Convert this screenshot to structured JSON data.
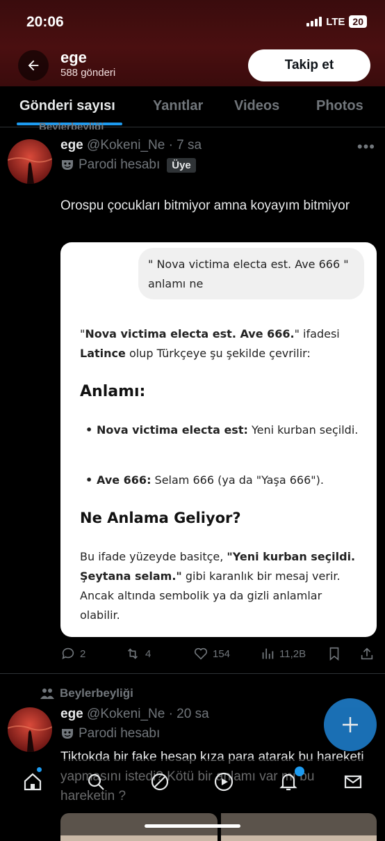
{
  "status": {
    "time": "20:06",
    "network": "LTE",
    "battery": "20"
  },
  "header": {
    "name": "ege",
    "post_count": "588 gönderi",
    "follow_label": "Takip et",
    "back_icon": "arrow-left-icon"
  },
  "tabs": [
    {
      "label": "Gönderi sayısı",
      "active": true
    },
    {
      "label": "Yanıtlar",
      "active": false
    },
    {
      "label": "Videos",
      "active": false
    },
    {
      "label": "Photos",
      "active": false
    }
  ],
  "ghost_social": "Beylerbeyliği",
  "tweet1": {
    "name": "ege",
    "handle": "@Kokeni_Ne",
    "time": "· 7 sa",
    "badge_text": "Parodi hesabı",
    "member_label": "Üye",
    "text": "Orospu çocukları bitmiyor amna koyayım bitmiyor",
    "card": {
      "bubble": "\" Nova victima electa est. Ave 666 \" anlamı ne",
      "intro_pre": "\"",
      "intro_bold": "Nova victima electa est. Ave 666.",
      "intro_mid": "\" ifadesi ",
      "intro_bold2": "Latince",
      "intro_post": " olup Türkçeye şu şekilde çevrilir:",
      "heading1": "Anlamı:",
      "bullets": [
        {
          "bold": "Nova victima electa est:",
          "text": " Yeni kurban seçildi."
        },
        {
          "bold": "Ave 666:",
          "text": " Selam 666 (ya da \"Yaşa 666\")."
        }
      ],
      "heading2": "Ne Anlama Geliyor?",
      "p2_pre": "Bu ifade yüzeyde basitçe, ",
      "p2_bold": "\"Yeni kurban seçildi. Şeytana selam.\"",
      "p2_post": " gibi karanlık bir mesaj verir. Ancak altında sembolik ya da gizli anlamlar olabilir."
    },
    "actions": {
      "replies": "2",
      "retweets": "4",
      "likes": "154",
      "views": "11,2B"
    }
  },
  "tweet2": {
    "social_context": "Beylerbeyliği",
    "name": "ege",
    "handle": "@Kokeni_Ne",
    "time": "· 20 sa",
    "badge_text": "Parodi hesabı",
    "text": "Tiktokda bir fake hesap kıza para atarak bu hareketi yapmasını istedi? Kötü bir anlamı var mı bu hareketin ?"
  },
  "colors": {
    "accent": "#1d9bf0",
    "header_bg": "#4a0f10",
    "text_secondary": "#71767b"
  }
}
